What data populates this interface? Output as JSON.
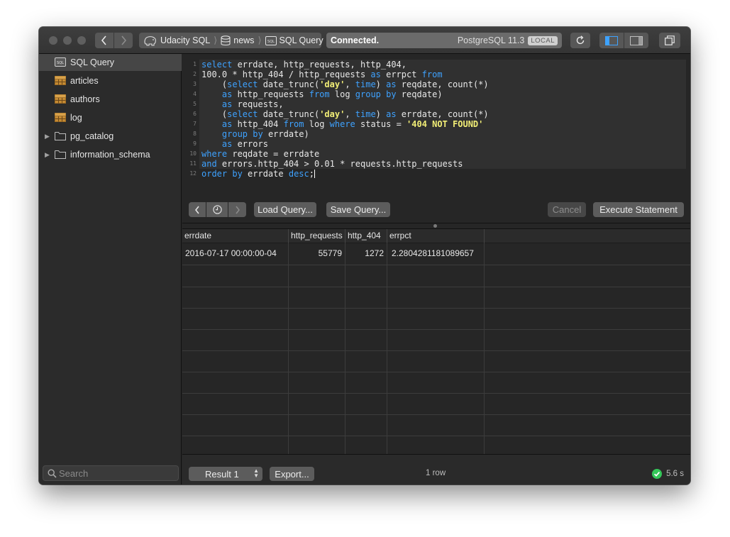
{
  "toolbar": {
    "breadcrumbs": [
      "Udacity SQL",
      "news",
      "SQL Query"
    ],
    "status": "Connected.",
    "server": "PostgreSQL 11.3",
    "server_badge": "LOCAL"
  },
  "sidebar": {
    "items": [
      {
        "label": "SQL Query",
        "icon": "sql-query-icon",
        "selected": true
      },
      {
        "label": "articles",
        "icon": "table-icon"
      },
      {
        "label": "authors",
        "icon": "table-icon"
      },
      {
        "label": "log",
        "icon": "table-icon"
      },
      {
        "label": "pg_catalog",
        "icon": "folder-icon",
        "expandable": true
      },
      {
        "label": "information_schema",
        "icon": "folder-icon",
        "expandable": true
      }
    ],
    "search_placeholder": "Search"
  },
  "editor": {
    "line_numbers": [
      "1",
      "2",
      "3",
      "4",
      "5",
      "6",
      "7",
      "8",
      "9",
      "10",
      "11",
      "12"
    ],
    "lines": [
      "select errdate, http_requests, http_404,",
      "100.0 * http_404 / http_requests as errpct from",
      "    (select date_trunc('day', time) as reqdate, count(*)",
      "    as http_requests from log group by reqdate)",
      "    as requests,",
      "    (select date_trunc('day', time) as errdate, count(*)",
      "    as http_404 from log where status = '404 NOT FOUND'",
      "    group by errdate)",
      "    as errors",
      "where reqdate = errdate",
      "and errors.http_404 > 0.01 * requests.http_requests",
      "order by errdate desc;"
    ],
    "buttons": {
      "load": "Load Query...",
      "save": "Save Query...",
      "cancel": "Cancel",
      "execute": "Execute Statement"
    }
  },
  "results": {
    "columns": [
      "errdate",
      "http_requests",
      "http_404",
      "errpct"
    ],
    "rows": [
      [
        "2016-07-17 00:00:00-04",
        "55779",
        "1272",
        "2.2804281181089657"
      ]
    ]
  },
  "bottombar": {
    "result_label": "Result 1",
    "export_label": "Export...",
    "row_count": "1 row",
    "elapsed": "5.6 s",
    "status_color": "#34c759"
  }
}
